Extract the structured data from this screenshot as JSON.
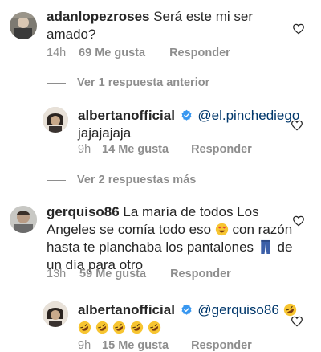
{
  "comments": [
    {
      "username": "adanlopezroses",
      "text_line1": " Será este mi ser",
      "text_line2": "amado?",
      "time": "14h",
      "likes": "69 Me gusta",
      "reply": "Responder"
    },
    {
      "username": "albertanofficial",
      "mention": "@el.pinchediego",
      "text_line2": "jajajajaja",
      "time": "9h",
      "likes": "14 Me gusta",
      "reply": "Responder"
    },
    {
      "username": "gerquiso86",
      "text_line1": " La maría de todos Los",
      "text_line2a": "Angeles se comía todo eso ",
      "text_line2b": " con razón",
      "text_line3a": "hasta te planchaba los pantalones ",
      "text_line3b": " de",
      "text_line4": "un día para otro",
      "time": "13h",
      "likes": "59 Me gusta",
      "reply": "Responder"
    },
    {
      "username": "albertanofficial",
      "mention": "@gerquiso86",
      "time": "9h",
      "likes": "15 Me gusta",
      "reply": "Responder"
    }
  ],
  "toggles": {
    "previous_reply": "Ver 1 respuesta anterior",
    "more_replies": "Ver 2 respuestas más"
  },
  "icons": {
    "heart": "heart-outline-icon",
    "verified": "verified-badge-icon",
    "emoji_smiling": "smiling-face-with-heart-eyes-icon",
    "emoji_rofl": "rolling-on-floor-laughing-icon",
    "emoji_jeans": "jeans-icon"
  },
  "colors": {
    "text": "#262626",
    "meta": "#8e8e8e",
    "mention": "#00376b",
    "verified": "#3897f0"
  }
}
